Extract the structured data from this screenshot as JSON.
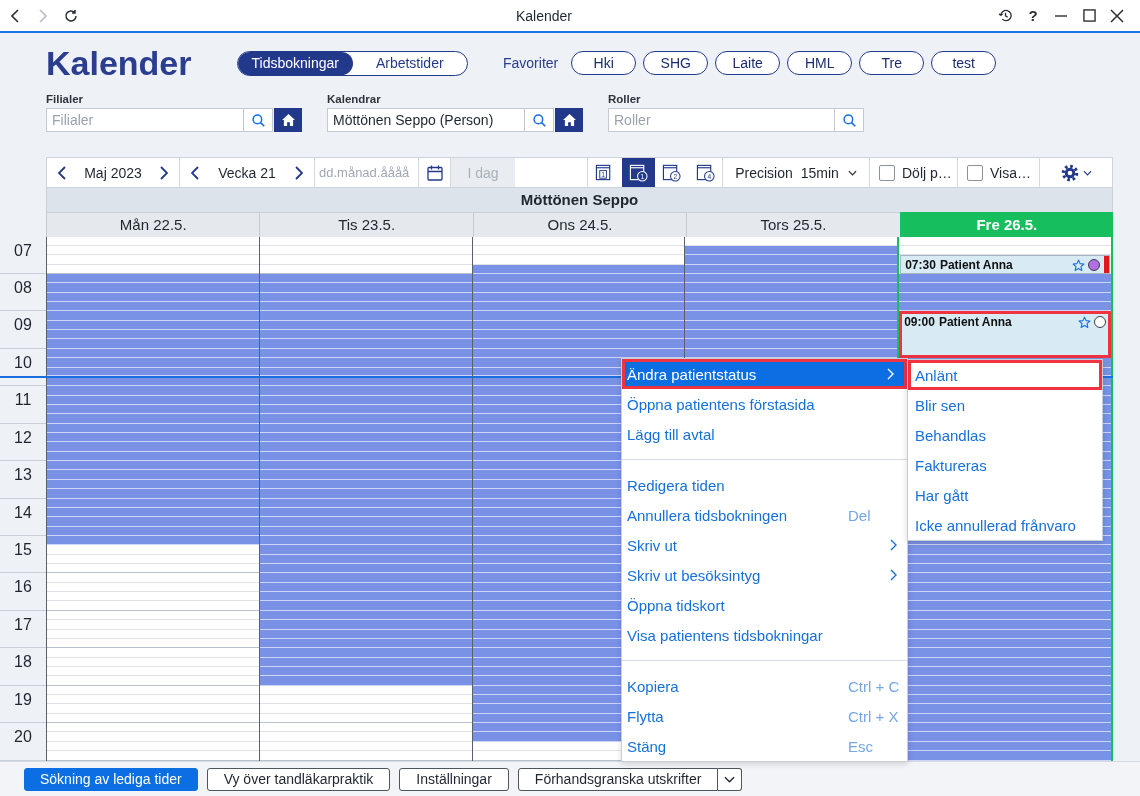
{
  "titlebar": {
    "title": "Kalender",
    "help": "?",
    "nav": [
      {
        "kind": "back",
        "disabled": false
      },
      {
        "kind": "forward",
        "disabled": true
      },
      {
        "kind": "refresh",
        "disabled": false
      }
    ]
  },
  "page_title": "Kalender",
  "modes": [
    {
      "label": "Tidsbokningar",
      "selected": true
    },
    {
      "label": "Arbetstider",
      "selected": false
    }
  ],
  "favorites": {
    "label": "Favoriter",
    "items": [
      "Hki",
      "SHG",
      "Laite",
      "HML",
      "Tre",
      "test"
    ]
  },
  "filters": [
    {
      "label": "Filialer",
      "placeholder": "Filialer",
      "home": true
    },
    {
      "label": "Kalendrar",
      "value": "Möttönen Seppo (Person)",
      "home": true
    },
    {
      "label": "Roller",
      "placeholder": "Roller",
      "home": false
    }
  ],
  "toolbar": {
    "month": "Maj 2023",
    "week": "Vecka 21",
    "date_field": {
      "placeholder": "dd.månad.åååå"
    },
    "today": {
      "label": "I dag",
      "disabled": true
    },
    "views": [
      {
        "kind": "boxed",
        "label": "1",
        "selected": false
      },
      {
        "kind": "circled",
        "label": "1",
        "selected": true
      },
      {
        "kind": "circled",
        "label": "2",
        "selected": false
      },
      {
        "kind": "circled",
        "label": "4",
        "selected": false
      }
    ],
    "precision": {
      "label": "Precision",
      "value": "15min"
    },
    "checkboxes": [
      {
        "label": "Dölj p…",
        "checked": false
      },
      {
        "label": "Visa…",
        "checked": false
      }
    ]
  },
  "calendar": {
    "person": "Möttönen Seppo",
    "hours": [
      {
        "label": "07",
        "current": false
      },
      {
        "label": "08",
        "current": false
      },
      {
        "label": "09",
        "current": false
      },
      {
        "label": "10",
        "current": true
      },
      {
        "label": "11",
        "current": false
      },
      {
        "label": "12",
        "current": false
      },
      {
        "label": "13",
        "current": false
      },
      {
        "label": "14",
        "current": false
      },
      {
        "label": "15",
        "current": false
      },
      {
        "label": "16",
        "current": false
      },
      {
        "label": "17",
        "current": false
      },
      {
        "label": "18",
        "current": false
      },
      {
        "label": "19",
        "current": false
      },
      {
        "label": "20",
        "current": false
      }
    ],
    "days": [
      {
        "label": "Mån 22.5.",
        "today": false,
        "slots": [
          {
            "open": false
          },
          {
            "open": false
          },
          {
            "open": false
          },
          {
            "open": false
          },
          {
            "open": true
          },
          {
            "open": true
          },
          {
            "open": true
          },
          {
            "open": true
          },
          {
            "open": true
          },
          {
            "open": true
          },
          {
            "open": true
          },
          {
            "open": true
          },
          {
            "open": true
          },
          {
            "open": true
          },
          {
            "open": true
          },
          {
            "open": true
          },
          {
            "open": true
          },
          {
            "open": true
          },
          {
            "open": true
          },
          {
            "open": true
          },
          {
            "open": true
          },
          {
            "open": true
          },
          {
            "open": true
          },
          {
            "open": true
          },
          {
            "open": true
          },
          {
            "open": true
          },
          {
            "open": true
          },
          {
            "open": true
          },
          {
            "open": true
          },
          {
            "open": true
          },
          {
            "open": true
          },
          {
            "open": true
          },
          {
            "open": true
          },
          {
            "open": false
          },
          {
            "open": false
          },
          {
            "open": false
          },
          {
            "open": false
          },
          {
            "open": false
          },
          {
            "open": false
          },
          {
            "open": false
          },
          {
            "open": false
          },
          {
            "open": false
          },
          {
            "open": false
          },
          {
            "open": false
          },
          {
            "open": false
          },
          {
            "open": false
          },
          {
            "open": false
          },
          {
            "open": false
          },
          {
            "open": false
          },
          {
            "open": false
          },
          {
            "open": false
          },
          {
            "open": false
          },
          {
            "open": false
          },
          {
            "open": false
          },
          {
            "open": false
          },
          {
            "open": false
          }
        ]
      },
      {
        "label": "Tis 23.5.",
        "today": false,
        "slots": [
          {
            "open": false
          },
          {
            "open": false
          },
          {
            "open": false
          },
          {
            "open": false
          },
          {
            "open": true
          },
          {
            "open": true
          },
          {
            "open": true
          },
          {
            "open": true
          },
          {
            "open": true
          },
          {
            "open": true
          },
          {
            "open": true
          },
          {
            "open": true
          },
          {
            "open": true
          },
          {
            "open": true
          },
          {
            "open": true
          },
          {
            "open": true
          },
          {
            "open": true
          },
          {
            "open": true
          },
          {
            "open": true
          },
          {
            "open": true
          },
          {
            "open": true
          },
          {
            "open": true
          },
          {
            "open": true
          },
          {
            "open": true
          },
          {
            "open": true
          },
          {
            "open": true
          },
          {
            "open": true
          },
          {
            "open": true
          },
          {
            "open": true
          },
          {
            "open": true
          },
          {
            "open": true
          },
          {
            "open": true
          },
          {
            "open": true
          },
          {
            "open": true
          },
          {
            "open": true
          },
          {
            "open": true
          },
          {
            "open": true
          },
          {
            "open": true
          },
          {
            "open": true
          },
          {
            "open": true
          },
          {
            "open": true
          },
          {
            "open": true
          },
          {
            "open": true
          },
          {
            "open": true
          },
          {
            "open": true
          },
          {
            "open": true
          },
          {
            "open": true
          },
          {
            "open": true
          },
          {
            "open": false
          },
          {
            "open": false
          },
          {
            "open": false
          },
          {
            "open": false
          },
          {
            "open": false
          },
          {
            "open": false
          },
          {
            "open": false
          },
          {
            "open": false
          }
        ]
      },
      {
        "label": "Ons 24.5.",
        "today": false,
        "slots": [
          {
            "open": false
          },
          {
            "open": false
          },
          {
            "open": false
          },
          {
            "open": true
          },
          {
            "open": true
          },
          {
            "open": true
          },
          {
            "open": true
          },
          {
            "open": true
          },
          {
            "open": true
          },
          {
            "open": true
          },
          {
            "open": true
          },
          {
            "open": true
          },
          {
            "open": true
          },
          {
            "open": true
          },
          {
            "open": true
          },
          {
            "open": true
          },
          {
            "open": true
          },
          {
            "open": true
          },
          {
            "open": true
          },
          {
            "open": true
          },
          {
            "open": true
          },
          {
            "open": true
          },
          {
            "open": true
          },
          {
            "open": true
          },
          {
            "open": true
          },
          {
            "open": true
          },
          {
            "open": true
          },
          {
            "open": true
          },
          {
            "open": true
          },
          {
            "open": true
          },
          {
            "open": true
          },
          {
            "open": true
          },
          {
            "open": true
          },
          {
            "open": true
          },
          {
            "open": true
          },
          {
            "open": true
          },
          {
            "open": true
          },
          {
            "open": true
          },
          {
            "open": true
          },
          {
            "open": true
          },
          {
            "open": true
          },
          {
            "open": true
          },
          {
            "open": true
          },
          {
            "open": true
          },
          {
            "open": true
          },
          {
            "open": true
          },
          {
            "open": true
          },
          {
            "open": true
          },
          {
            "open": true
          },
          {
            "open": true
          },
          {
            "open": true
          },
          {
            "open": true
          },
          {
            "open": true
          },
          {
            "open": true
          },
          {
            "open": false
          },
          {
            "open": false
          }
        ]
      },
      {
        "label": "Tors 25.5.",
        "today": false,
        "slots": [
          {
            "open": false
          },
          {
            "open": true
          },
          {
            "open": true
          },
          {
            "open": true
          },
          {
            "open": true
          },
          {
            "open": true
          },
          {
            "open": true
          },
          {
            "open": true
          },
          {
            "open": true
          },
          {
            "open": true
          },
          {
            "open": true
          },
          {
            "open": true
          },
          {
            "open": true
          }
        ]
      },
      {
        "label": "Fre 26.5.",
        "today": true,
        "slots": [
          {
            "kind": "slot",
            "open": false
          },
          {
            "kind": "slot",
            "open": false
          },
          {
            "kind": "appointment",
            "time": "07:30",
            "patient": "Patient Anna",
            "color": "#b26ee2",
            "flagged": true,
            "highlighted": false
          },
          {
            "kind": "booked"
          },
          {
            "kind": "slot",
            "open": true
          },
          {
            "kind": "slot",
            "open": true
          },
          {
            "kind": "slot",
            "open": true
          },
          {
            "kind": "slot",
            "open": true
          },
          {
            "kind": "appointment",
            "time": "09:00",
            "patient": "Patient Anna",
            "color": "#ffffff",
            "flagged": false,
            "highlighted": true
          },
          {
            "kind": "booked"
          },
          {
            "kind": "booked"
          },
          {
            "kind": "booked"
          },
          {
            "kind": "booked"
          },
          {
            "kind": "slot",
            "open": true
          },
          {
            "kind": "slot",
            "open": true
          },
          {
            "kind": "slot",
            "open": true
          },
          {
            "kind": "slot",
            "open": true
          },
          {
            "kind": "slot",
            "open": true
          },
          {
            "kind": "slot",
            "open": true
          },
          {
            "kind": "slot",
            "open": true
          },
          {
            "kind": "slot",
            "open": true
          },
          {
            "kind": "slot",
            "open": true
          },
          {
            "kind": "slot",
            "open": true
          },
          {
            "kind": "slot",
            "open": true
          },
          {
            "kind": "slot",
            "open": true
          },
          {
            "kind": "slot",
            "open": true
          },
          {
            "kind": "slot",
            "open": true
          },
          {
            "kind": "slot",
            "open": true
          },
          {
            "kind": "slot",
            "open": true
          },
          {
            "kind": "slot",
            "open": true
          },
          {
            "kind": "slot",
            "open": true
          },
          {
            "kind": "slot",
            "open": true
          },
          {
            "kind": "slot",
            "open": true
          },
          {
            "kind": "slot",
            "open": true
          },
          {
            "kind": "slot",
            "open": true
          },
          {
            "kind": "slot",
            "open": true
          },
          {
            "kind": "slot",
            "open": true
          },
          {
            "kind": "slot",
            "open": true
          },
          {
            "kind": "slot",
            "open": true
          },
          {
            "kind": "slot",
            "open": true
          },
          {
            "kind": "slot",
            "open": true
          },
          {
            "kind": "slot",
            "open": true
          },
          {
            "kind": "slot",
            "open": true
          },
          {
            "kind": "slot",
            "open": true
          },
          {
            "kind": "slot",
            "open": true
          },
          {
            "kind": "slot",
            "open": true
          },
          {
            "kind": "slot",
            "open": true
          },
          {
            "kind": "slot",
            "open": true
          },
          {
            "kind": "slot",
            "open": true
          },
          {
            "kind": "slot",
            "open": true
          },
          {
            "kind": "slot",
            "open": true
          },
          {
            "kind": "slot",
            "open": true
          },
          {
            "kind": "slot",
            "open": true
          },
          {
            "kind": "slot",
            "open": true
          },
          {
            "kind": "slot",
            "open": true
          },
          {
            "kind": "slot",
            "open": true
          }
        ]
      }
    ]
  },
  "context_menu": {
    "groups": [
      {
        "items": [
          {
            "label": "Ändra patientstatus",
            "has_submenu": true,
            "selected": true,
            "highlighted": true
          },
          {
            "label": "Öppna patientens förstasida",
            "has_submenu": false,
            "selected": false,
            "highlighted": false
          },
          {
            "label": "Lägg till avtal",
            "has_submenu": false,
            "selected": false,
            "highlighted": false
          }
        ]
      },
      {
        "items": [
          {
            "label": "Redigera tiden",
            "has_submenu": false,
            "selected": false,
            "highlighted": false
          },
          {
            "label": "Annullera tidsbokningen",
            "shortcut": "Del",
            "has_submenu": false,
            "selected": false,
            "highlighted": false
          },
          {
            "label": "Skriv ut",
            "has_submenu": true,
            "selected": false,
            "highlighted": false
          },
          {
            "label": "Skriv ut besöksintyg",
            "has_submenu": true,
            "selected": false,
            "highlighted": false
          },
          {
            "label": "Öppna tidskort",
            "has_submenu": false,
            "selected": false,
            "highlighted": false
          },
          {
            "label": "Visa patientens tidsbokningar",
            "has_submenu": false,
            "selected": false,
            "highlighted": false
          }
        ]
      },
      {
        "items": [
          {
            "label": "Kopiera",
            "shortcut": "Ctrl + C",
            "has_submenu": false,
            "selected": false,
            "highlighted": false
          },
          {
            "label": "Flytta",
            "shortcut": "Ctrl + X",
            "has_submenu": false,
            "selected": false,
            "highlighted": false
          },
          {
            "label": "Stäng",
            "shortcut": "Esc",
            "has_submenu": false,
            "selected": false,
            "highlighted": false
          }
        ]
      }
    ]
  },
  "submenu": {
    "items": [
      {
        "label": "Anlänt",
        "highlighted": true
      },
      {
        "label": "Blir sen",
        "highlighted": false
      },
      {
        "label": "Behandlas",
        "highlighted": false
      },
      {
        "label": "Faktureras",
        "highlighted": false
      },
      {
        "label": "Har gått",
        "highlighted": false
      },
      {
        "label": "Icke annullerad frånvaro",
        "highlighted": false
      }
    ]
  },
  "footer": {
    "buttons": [
      {
        "label": "Sökning av lediga tider",
        "kind": "primary"
      },
      {
        "label": "Vy över tandläkarpraktik",
        "kind": "default"
      },
      {
        "label": "Inställningar",
        "kind": "default"
      },
      {
        "label": "Förhandsgranska utskrifter",
        "kind": "split"
      }
    ]
  }
}
